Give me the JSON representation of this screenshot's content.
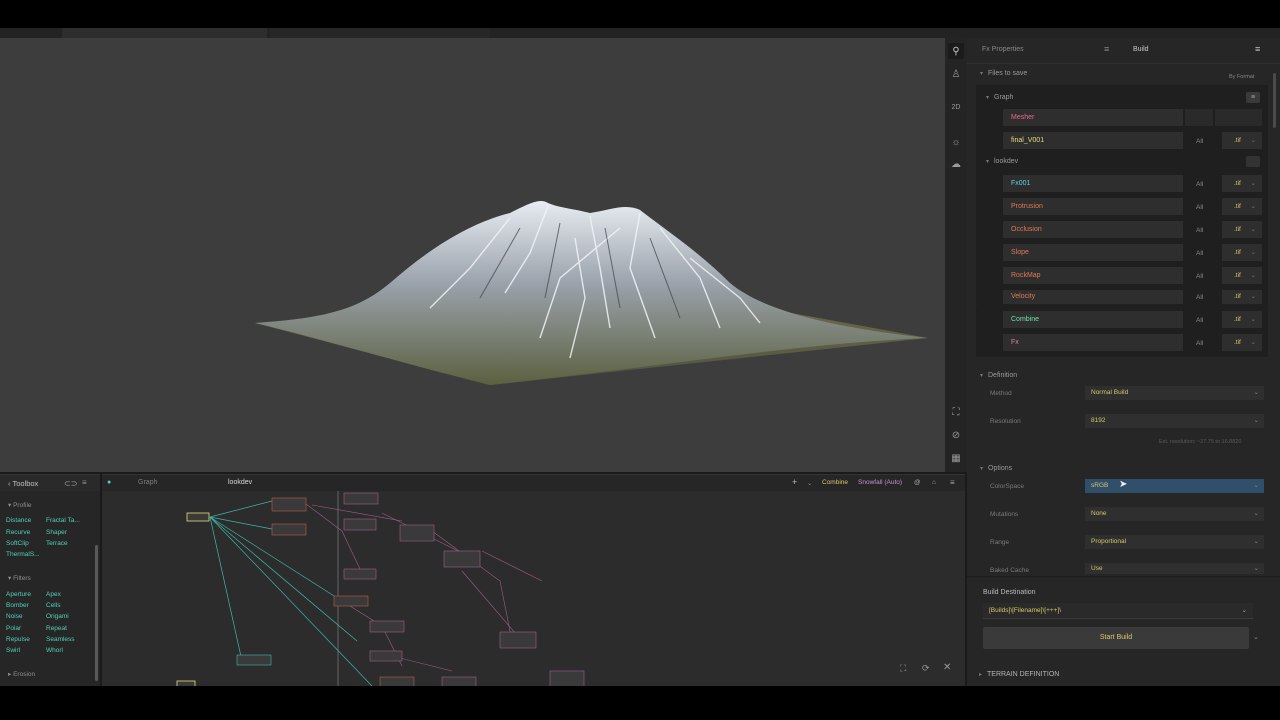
{
  "graph": {
    "tabs": [
      {
        "label": "Graph",
        "active": false
      },
      {
        "label": "lookdev",
        "active": true
      }
    ],
    "header_right": {
      "node_name": "Combine",
      "mode": "Snowfall (Auto)"
    }
  },
  "toolbox": {
    "title": "Toolbox",
    "sections": [
      {
        "name": "Profile",
        "items": [
          "Distance",
          "Fractal Ta...",
          "Recurve",
          "Shaper",
          "SoftClip",
          "Terrace",
          "ThermalS..."
        ]
      },
      {
        "name": "Filters",
        "items": [
          "Aperture",
          "Apex",
          "Bomber",
          "Cells",
          "Noise",
          "Origami",
          "Polar",
          "Repeat",
          "Repulse",
          "Seamless",
          "Swirl",
          "Whorl"
        ]
      },
      {
        "name": "Erosion",
        "items": []
      }
    ]
  },
  "iconstrip": {
    "label_2d": "2D"
  },
  "panel": {
    "tabs": [
      {
        "label": "Fx Properties"
      },
      {
        "label": "Build",
        "active": true
      }
    ],
    "files_to_save": {
      "title": "Files to save",
      "sort": "By Format",
      "groups": [
        {
          "name": "Graph",
          "files": [
            {
              "name": "Mesher",
              "all": "",
              "ext": "",
              "color": "pink"
            },
            {
              "name": "final_V001",
              "all": "All",
              "ext": ".tif",
              "color": "yellow"
            }
          ]
        },
        {
          "name": "lookdev",
          "files": [
            {
              "name": "Fx001",
              "all": "All",
              "ext": ".tif",
              "color": "cyan"
            },
            {
              "name": "Protrusion",
              "all": "All",
              "ext": ".tif",
              "color": "orange"
            },
            {
              "name": "Occlusion",
              "all": "All",
              "ext": ".tif",
              "color": "orange"
            },
            {
              "name": "Slope",
              "all": "All",
              "ext": ".tif",
              "color": "orange"
            },
            {
              "name": "RockMap",
              "all": "All",
              "ext": ".tif",
              "color": "orange"
            },
            {
              "name": "Velocity",
              "all": "All",
              "ext": ".tif",
              "color": "orange"
            },
            {
              "name": "Combine",
              "all": "All",
              "ext": ".tif",
              "color": "green"
            },
            {
              "name": "Fx",
              "all": "All",
              "ext": ".tif",
              "color": "mag"
            }
          ]
        }
      ]
    },
    "definition": {
      "title": "Definition",
      "method_label": "Method",
      "method_value": "Normal Build",
      "resolution_label": "Resolution",
      "resolution_value": "8192",
      "note": "Est. resolution: ~27.75 to 16.8820"
    },
    "options": {
      "title": "Options",
      "colorspace_label": "ColorSpace",
      "colorspace_value": "sRGB",
      "mutations_label": "Mutations",
      "mutations_value": "None",
      "range_label": "Range",
      "range_value": "Proportional",
      "baked_label": "Baked Cache",
      "baked_value": "Use"
    },
    "build": {
      "destination_label": "Build Destination",
      "destination_value": "[Builds]\\[Filename]\\[+++]\\",
      "start_label": "Start Build",
      "terrain_definition": "TERRAIN DEFINITION"
    }
  }
}
